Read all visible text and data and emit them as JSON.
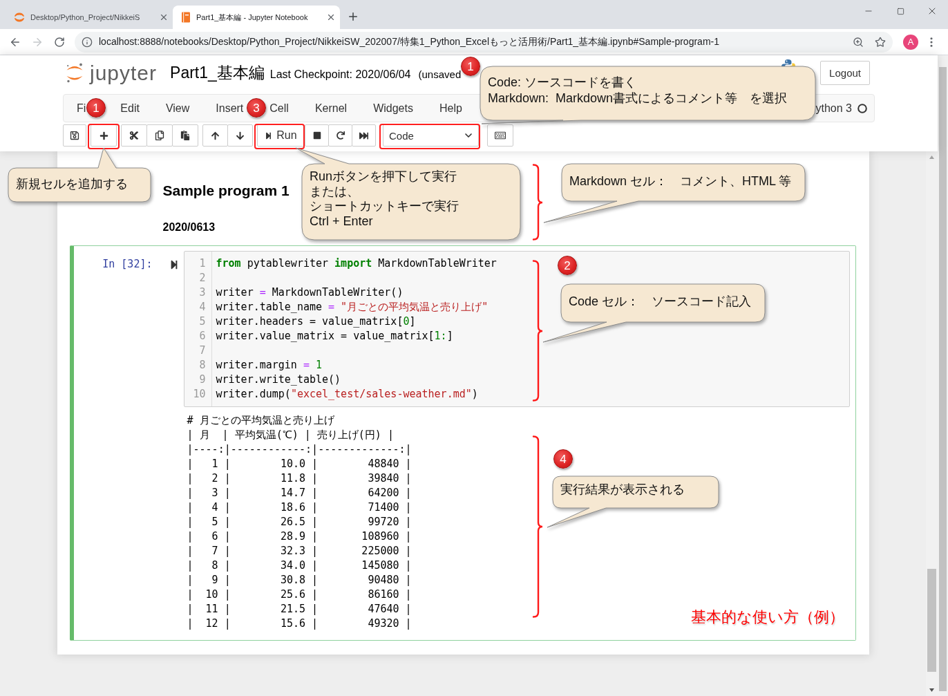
{
  "browser": {
    "tabs": [
      {
        "kind": "tree",
        "title": "Desktop/Python_Project/NikkeiS",
        "selected": false
      },
      {
        "kind": "notebook",
        "title": "Part1_基本編 - Jupyter Notebook",
        "selected": true
      }
    ],
    "forward_disabled": true,
    "url": "localhost:8888/notebooks/Desktop/Python_Project/NikkeiSW_202007/特集1_Python_Excelもっと活用術/Part1_基本編.ipynb#Sample-program-1",
    "avatar": "A"
  },
  "header": {
    "logo": "jupyter",
    "title": "Part1_基本編",
    "checkpoint": "Last Checkpoint: 2020/06/04",
    "save_status": "(unsaved",
    "logout": "Logout"
  },
  "menu": {
    "items": [
      "Fi",
      "Edit",
      "View",
      "Insert",
      "Cell",
      "Kernel",
      "Widgets",
      "Help"
    ],
    "kernel": "ython 3"
  },
  "toolbar": {
    "run": "Run",
    "cell_type": "Code"
  },
  "notebook": {
    "markdown": {
      "heading": "Sample program 1",
      "date": "2020/0613"
    },
    "code_cell": {
      "selected": true,
      "prompt": "In [32]:",
      "lines": [
        {
          "number": "1",
          "tokens": [
            {
              "kind": "keyword",
              "text": "from"
            },
            {
              "kind": "plain",
              "text": " pytablewriter "
            },
            {
              "kind": "keyword",
              "text": "import"
            },
            {
              "kind": "plain",
              "text": " MarkdownTableWriter"
            }
          ]
        },
        {
          "number": "2"
        },
        {
          "number": "3",
          "tokens": [
            {
              "kind": "plain",
              "text": "writer "
            },
            {
              "kind": "operator",
              "text": "="
            },
            {
              "kind": "plain",
              "text": " MarkdownTableWriter()"
            }
          ]
        },
        {
          "number": "4",
          "tokens": [
            {
              "kind": "plain",
              "text": "writer.table_name "
            },
            {
              "kind": "operator",
              "text": "="
            },
            {
              "kind": "string",
              "text": " \"月ごとの平均気温と売り上げ\""
            }
          ]
        },
        {
          "number": "5",
          "tokens": [
            {
              "kind": "plain",
              "text": "writer.headers = value_matrix["
            },
            {
              "kind": "number",
              "text": "0"
            },
            {
              "kind": "plain",
              "text": "]"
            }
          ]
        },
        {
          "number": "6",
          "tokens": [
            {
              "kind": "plain",
              "text": "writer.value_matrix = value_matrix["
            },
            {
              "kind": "number",
              "text": "1:"
            },
            {
              "kind": "plain",
              "text": "]"
            }
          ]
        },
        {
          "number": "7"
        },
        {
          "number": "8",
          "tokens": [
            {
              "kind": "plain",
              "text": "writer.margin "
            },
            {
              "kind": "operator",
              "text": "="
            },
            {
              "kind": "number",
              "text": " 1"
            }
          ]
        },
        {
          "number": "9",
          "tokens": [
            {
              "kind": "plain",
              "text": "writer.write_table()"
            }
          ]
        },
        {
          "number": "10",
          "tokens": [
            {
              "kind": "plain",
              "text": "writer.dump("
            },
            {
              "kind": "string",
              "text": "\"excel_test/sales-weather.md\""
            },
            {
              "kind": "plain",
              "text": ")"
            }
          ]
        }
      ],
      "output": [
        "# 月ごとの平均気温と売り上げ",
        "| 月  | 平均気温(℃) | 売り上げ(円) |",
        "|----:|------------:|-------------:|",
        "|   1 |        10.0 |        48840 |",
        "|   2 |        11.8 |        39840 |",
        "|   3 |        14.7 |        64200 |",
        "|   4 |        18.6 |        71400 |",
        "|   5 |        26.5 |        99720 |",
        "|   6 |        28.9 |       108960 |",
        "|   7 |        32.3 |       225000 |",
        "|   8 |        34.0 |       145080 |",
        "|   9 |        30.8 |        90480 |",
        "|  10 |        25.6 |        86160 |",
        "|  11 |        21.5 |        47640 |",
        "|  12 |        15.6 |        49320 |"
      ]
    }
  },
  "annotations": {
    "badges": [
      "1",
      "1",
      "3",
      "2",
      "4"
    ],
    "callouts": [
      {
        "lines": [
          "Code: ソースコードを書く",
          "Markdown:  Markdown書式によるコメント等　を選択"
        ]
      },
      {
        "lines": [
          "新規セルを追加する"
        ]
      },
      {
        "lines": [
          "Runボタンを押下して実行",
          "または、",
          "ショートカットキーで実行",
          "Ctrl + Enter"
        ]
      },
      {
        "lines": [
          "Markdown セル：　コメント、HTML 等"
        ]
      },
      {
        "lines": [
          "Code セル：　ソースコード記入"
        ]
      },
      {
        "lines": [
          "実行結果が表示される"
        ]
      }
    ],
    "caption": "基本的な使い方（例）"
  }
}
